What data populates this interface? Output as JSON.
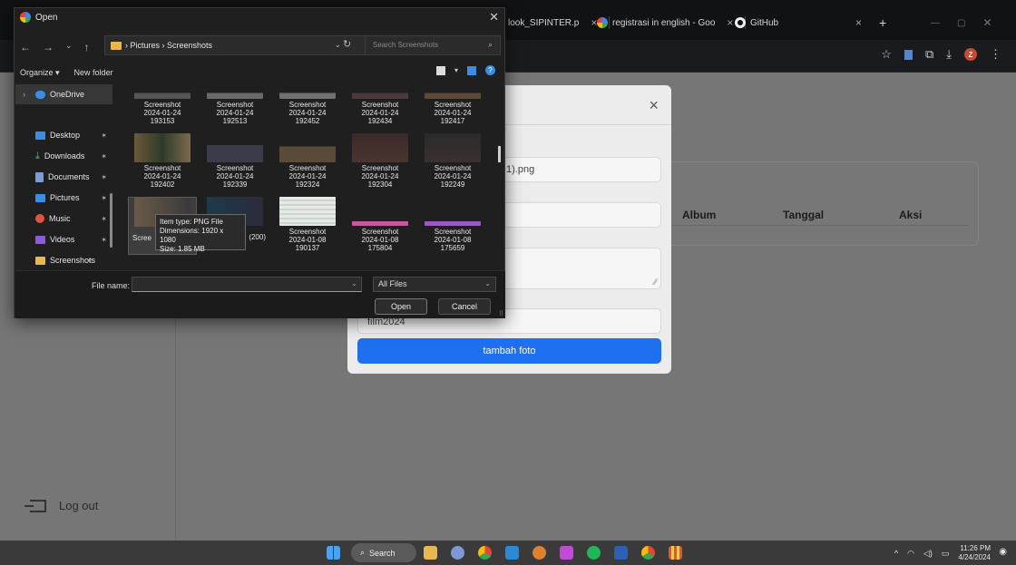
{
  "browser": {
    "tabs": [
      {
        "label": "look_SIPINTER.p",
        "icon": "pdf-icon"
      },
      {
        "label": "registrasi in english - Goo",
        "icon": "google-icon"
      },
      {
        "label": "GitHub",
        "icon": "github-icon"
      }
    ],
    "toolbar_icons": [
      "star-icon",
      "extension-icon",
      "puzzle-icon",
      "download-icon",
      "profile-icon",
      "more-icon"
    ],
    "profile_initial": "Z"
  },
  "page": {
    "logout_label": "Log out",
    "table_headers": [
      "Album",
      "Tanggal",
      "Aksi"
    ]
  },
  "modal": {
    "close_glyph": "×",
    "file_value": "1).png",
    "album_value": "film2024",
    "submit_label": "tambah foto"
  },
  "dialog": {
    "title": "Open",
    "close_glyph": "✕",
    "breadcrumb": "› Pictures › Screenshots",
    "search_placeholder": "Search Screenshots",
    "organize_label": "Organize ▾",
    "new_folder_label": "New folder",
    "nav": [
      {
        "label": "OneDrive",
        "color": "#3a8ee6"
      },
      {
        "label": "Desktop",
        "color": "#3a8ee6"
      },
      {
        "label": "Downloads",
        "color": "#4fc08d"
      },
      {
        "label": "Documents",
        "color": "#7c9cd6"
      },
      {
        "label": "Pictures",
        "color": "#3a8ee6"
      },
      {
        "label": "Music",
        "color": "#e0553d"
      },
      {
        "label": "Videos",
        "color": "#8a5cd6"
      },
      {
        "label": "Screenshots",
        "color": "#e9b84c"
      }
    ],
    "files": [
      {
        "line1": "Screenshot",
        "line2": "2024-01-24",
        "line3": "193153"
      },
      {
        "line1": "Screenshot",
        "line2": "2024-01-24",
        "line3": "192513"
      },
      {
        "line1": "Screenshot",
        "line2": "2024-01-24",
        "line3": "192452"
      },
      {
        "line1": "Screenshot",
        "line2": "2024-01-24",
        "line3": "192434"
      },
      {
        "line1": "Screenshot",
        "line2": "2024-01-24",
        "line3": "192417"
      },
      {
        "line1": "Screenshot",
        "line2": "2024-01-24",
        "line3": "192402"
      },
      {
        "line1": "Screenshot",
        "line2": "2024-01-24",
        "line3": "192339"
      },
      {
        "line1": "Screenshot",
        "line2": "2024-01-24",
        "line3": "192324"
      },
      {
        "line1": "Screenshot",
        "line2": "2024-01-24",
        "line3": "192304"
      },
      {
        "line1": "Screenshot",
        "line2": "2024-01-24",
        "line3": "192249"
      },
      {
        "line1": "Scree",
        "line2": "",
        "line3": ""
      },
      {
        "line1": "(200)",
        "line2": "",
        "line3": ""
      },
      {
        "line1": "Screenshot",
        "line2": "2024-01-08",
        "line3": "190137"
      },
      {
        "line1": "Screenshot",
        "line2": "2024-01-08",
        "line3": "175804"
      },
      {
        "line1": "Screenshot",
        "line2": "2024-01-08",
        "line3": "175659"
      }
    ],
    "tooltip": {
      "line1": "Item type: PNG File",
      "line2": "Dimensions: 1920 x 1080",
      "line3": "Size: 1.85 MB"
    },
    "file_name_label": "File name:",
    "file_name_value": "",
    "file_type": "All Files",
    "open_label": "Open",
    "cancel_label": "Cancel"
  },
  "taskbar": {
    "search_label": "Search",
    "time": "11:26 PM",
    "date": "4/24/2024"
  }
}
